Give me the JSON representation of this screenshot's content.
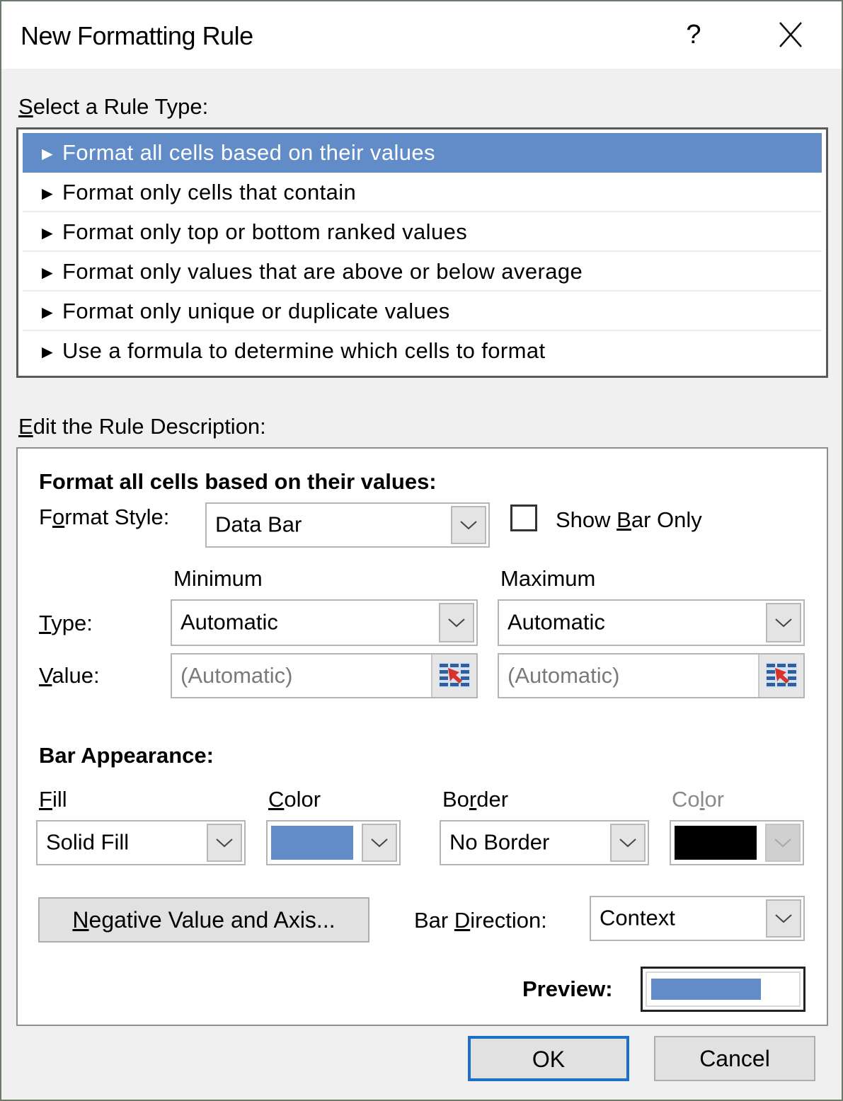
{
  "window": {
    "title": "New Formatting Rule",
    "help_label": "?",
    "close_icon": "close-x-icon"
  },
  "rule_type": {
    "label_prefix_u": "S",
    "label_rest": "elect a Rule Type:",
    "items": [
      {
        "label": "Format all cells based on their values",
        "selected": true
      },
      {
        "label": "Format only cells that contain",
        "selected": false
      },
      {
        "label": "Format only top or bottom ranked values",
        "selected": false
      },
      {
        "label": "Format only values that are above or below average",
        "selected": false
      },
      {
        "label": "Format only unique or duplicate values",
        "selected": false
      },
      {
        "label": "Use a formula to determine which cells to format",
        "selected": false
      }
    ],
    "item_icon": "►"
  },
  "description": {
    "label_u": "E",
    "label_rest": "dit the Rule Description:",
    "heading": "Format all cells based on their values:",
    "format_style": {
      "label_a": "F",
      "label_u": "o",
      "label_b": "rmat Style:",
      "value": "Data Bar"
    },
    "show_bar_only": {
      "label_a": "Show ",
      "label_u": "B",
      "label_b": "ar Only",
      "checked": false
    },
    "minimum_header": "Minimum",
    "maximum_header": "Maximum",
    "type_label_u": "T",
    "type_label_rest": "ype:",
    "value_label_u": "V",
    "value_label_rest": "alue:",
    "min_type": "Automatic",
    "max_type": "Automatic",
    "min_value": "(Automatic)",
    "max_value": "(Automatic)"
  },
  "bar_appearance": {
    "heading": "Bar Appearance:",
    "fill_label_u": "F",
    "fill_label_rest": "ill",
    "fill_value": "Solid Fill",
    "fill_color_label_u": "C",
    "fill_color_label_rest": "olor",
    "fill_color": "#628cc8",
    "border_label_a": "Bo",
    "border_label_u": "r",
    "border_label_b": "der",
    "border_value": "No Border",
    "border_color_label_a": "Co",
    "border_color_label_u": "l",
    "border_color_label_b": "or",
    "border_color": "#000000",
    "border_color_enabled": false,
    "negative_button_u": "N",
    "negative_button_rest": "egative Value and Axis...",
    "direction_label_a": "Bar ",
    "direction_label_u": "D",
    "direction_label_b": "irection:",
    "direction_value": "Context",
    "preview_label": "Preview:",
    "preview_fill_fraction": 0.75
  },
  "footer": {
    "ok_label": "OK",
    "cancel_label": "Cancel"
  },
  "colors": {
    "selection": "#628cc8",
    "default_button_border": "#1e6fc8"
  }
}
